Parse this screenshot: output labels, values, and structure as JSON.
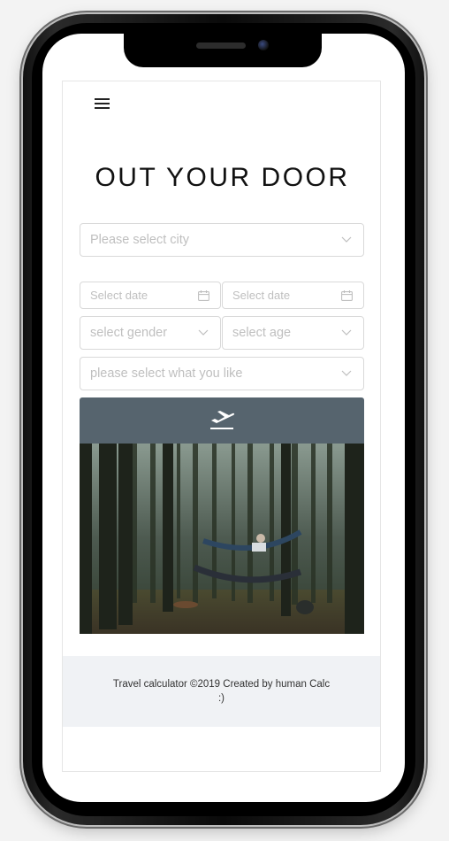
{
  "app": {
    "title": "OUT YOUR DOOR",
    "menu_icon": "hamburger-menu-icon"
  },
  "form": {
    "city": {
      "placeholder": "Please select city"
    },
    "start_date": {
      "placeholder": "Select date"
    },
    "end_date": {
      "placeholder": "Select date"
    },
    "gender": {
      "placeholder": "select gender"
    },
    "age": {
      "placeholder": "select age"
    },
    "interest": {
      "placeholder": "please select what you like"
    },
    "submit_icon": "airplane-takeoff-icon",
    "submit_color": "#56646e"
  },
  "hero_image": {
    "description_icon": "forest-hammock-photo"
  },
  "footer": {
    "line1": "Travel calculator ©2019 Created by human Calc",
    "line2": ":)"
  },
  "colors": {
    "placeholder": "#bfbfbf",
    "border": "#d9d9d9",
    "footer_bg": "#f0f2f5"
  }
}
